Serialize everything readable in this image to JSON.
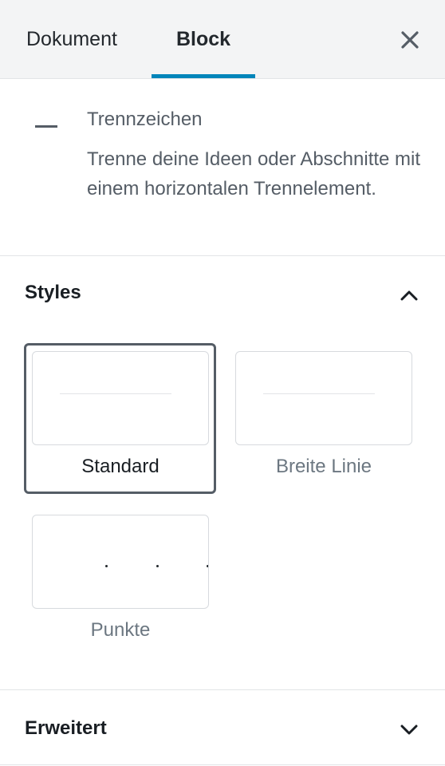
{
  "tabs": {
    "document_label": "Dokument",
    "block_label": "Block",
    "active": "Block",
    "accent_color": "#0085ba"
  },
  "close": {
    "icon": "close-icon"
  },
  "block": {
    "icon": "separator-icon",
    "title": "Trennzeichen",
    "description": "Trenne deine Ideen oder Abschnitte mit einem horizontalen Trennelement."
  },
  "styles_panel": {
    "title": "Styles",
    "expanded": true,
    "toggle_icon": "chevron-up-icon",
    "options": [
      {
        "label": "Standard",
        "selected": true
      },
      {
        "label": "Breite Linie",
        "selected": false
      },
      {
        "label": "Punkte",
        "selected": false
      }
    ]
  },
  "advanced_panel": {
    "title": "Erweitert",
    "expanded": false,
    "toggle_icon": "chevron-down-icon"
  }
}
